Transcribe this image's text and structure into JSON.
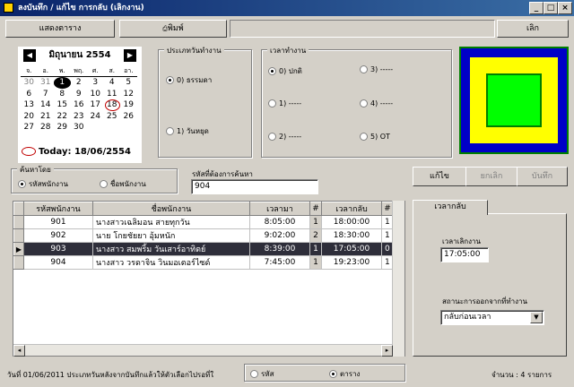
{
  "window": {
    "title": "ลงบันทึก / แก้ไข การกลับ (เลิกงาน)",
    "minimize": "_",
    "maximize": "□",
    "close": "×"
  },
  "toolbar": {
    "show_table": "แสดงตาราง",
    "print": "พิมพ์",
    "exit": "เลิก"
  },
  "calendar": {
    "month": "มิถุนายน 2554",
    "prev": "◀",
    "next": "▶",
    "dow": [
      "จ.",
      "อ.",
      "พ.",
      "พฤ.",
      "ศ.",
      "ส.",
      "อา."
    ],
    "weeks": [
      [
        "30",
        "31",
        "1",
        "2",
        "3",
        "4",
        "5"
      ],
      [
        "6",
        "7",
        "8",
        "9",
        "10",
        "11",
        "12"
      ],
      [
        "13",
        "14",
        "15",
        "16",
        "17",
        "18",
        "19"
      ],
      [
        "20",
        "21",
        "22",
        "23",
        "24",
        "25",
        "26"
      ],
      [
        "27",
        "28",
        "29",
        "30",
        "",
        "",
        ""
      ]
    ],
    "selected_day": "1",
    "today_day": "18",
    "today_label": "Today: 18/06/2554"
  },
  "daytype": {
    "legend": "ประเภทวันทำงาน",
    "normal": "0) ธรรมดา",
    "holiday": "1) วันหยุด"
  },
  "worktime": {
    "legend": "เวลาทำงาน",
    "opt0": "0) ปกติ",
    "opt1": "1) -----",
    "opt2": "2) -----",
    "opt3": "3) -----",
    "opt4": "4) -----",
    "opt5": "5) OT"
  },
  "search": {
    "legend": "ค้นหาโดย",
    "by_code": "รหัสพนักงาน",
    "by_name": "ชื่อพนักงาน",
    "label": "รหัสที่ต้องการค้นหา",
    "value": "904"
  },
  "actions": {
    "edit": "แก้ไข",
    "cancel": "ยกเลิก",
    "save": "บันทึก"
  },
  "table": {
    "headers": [
      "รหัสพนักงาน",
      "ชื่อพนักงาน",
      "เวลามา",
      "#",
      "เวลากลับ",
      "#"
    ],
    "rows": [
      {
        "code": "901",
        "name": "นางสาวเฉลิมอน สายทุกวัน",
        "in": "8:05:00",
        "n1": "1",
        "out": "18:00:00",
        "n2": "1"
      },
      {
        "code": "902",
        "name": "นาย โกยชัยยา อุ้มหนัก",
        "in": "9:02:00",
        "n1": "2",
        "out": "18:30:00",
        "n2": "1"
      },
      {
        "code": "903",
        "name": "นางสาว สมพริ้ม วันเสาร์อาทิตย์",
        "in": "8:39:00",
        "n1": "1",
        "out": "17:05:00",
        "n2": "0"
      },
      {
        "code": "904",
        "name": "นางสาว วรดาจิน วินมอเตอร์ไซด์",
        "in": "7:45:00",
        "n1": "1",
        "out": "19:23:00",
        "n2": "1"
      }
    ],
    "current_row_marker": "▶"
  },
  "detail": {
    "tab": "เวลากลับ",
    "finish_label": "เวลาเลิกงาน",
    "finish_value": "17:05:00",
    "leave_status_label": "สถานะการออกจากที่ทำงาน",
    "leave_status_value": "กลับก่อนเวลา"
  },
  "status": {
    "date_text": "วันที่ 01/06/2011  ประเภทวันหลังจากบันทึกแล้วให้ตัวเลือกไปรอที่ใ",
    "opt_code": "รหัส",
    "opt_table": "ตาราง",
    "count": "จำนวน : 4 รายการ"
  },
  "colors": {
    "outer_blue": "#0000c8",
    "ring_yellow": "#ffff00",
    "core_green": "#00ff00",
    "swatch_border": "#008000"
  }
}
